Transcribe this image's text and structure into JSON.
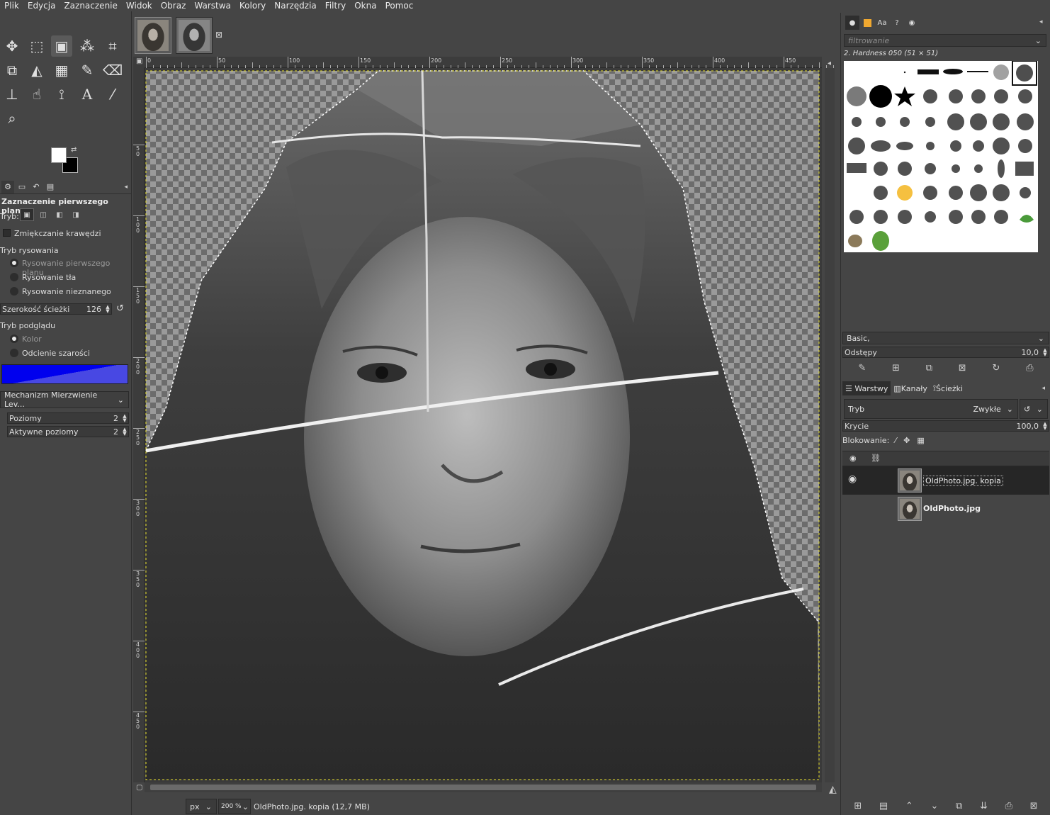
{
  "menu": [
    "Plik",
    "Edycja",
    "Zaznaczenie",
    "Widok",
    "Obraz",
    "Warstwa",
    "Kolory",
    "Narzędzia",
    "Filtry",
    "Okna",
    "Pomoc"
  ],
  "tool_options": {
    "title": "Zaznaczenie pierwszego planu",
    "mode_label": "Tryb:",
    "antialias_label": "Zmiękczanie krawędzi",
    "draw_mode_label": "Tryb rysowania",
    "draw_modes": [
      "Rysowanie pierwszego planu",
      "Rysowanie tła",
      "Rysowanie nieznanego"
    ],
    "stroke_width_label": "Szerokość ścieżki",
    "stroke_width_value": "126",
    "preview_mode_label": "Tryb podglądu",
    "preview_modes": [
      "Kolor",
      "Odcienie szarości"
    ],
    "preview_color": "#0000ee",
    "engine_label": "Mechanizm Mierzwienie Lev...",
    "levels_label": "Poziomy",
    "levels_value": "2",
    "active_levels_label": "Aktywne poziomy",
    "active_levels_value": "2"
  },
  "image_tabs": {
    "close_glyph": "⊠"
  },
  "ruler_top": [
    "0",
    "50",
    "100",
    "150",
    "200",
    "250",
    "300",
    "350",
    "400",
    "450"
  ],
  "ruler_left": [
    "5 0",
    "1 0 0",
    "1 5 0",
    "2 0 0",
    "2 5 0",
    "3 0 0",
    "3 5 0",
    "4 0 0",
    "4 5 0"
  ],
  "status": {
    "unit": "px",
    "zoom": "200 %",
    "info": "OldPhoto.jpg. kopia (12,7 MB)"
  },
  "brushes": {
    "filter_placeholder": "filtrowanie",
    "current_brush": "2. Hardness 050 (51 × 51)",
    "preset": "Basic,",
    "spacing_label": "Odstępy",
    "spacing_value": "10,0"
  },
  "layers": {
    "tabs": [
      "Warstwy",
      "Kanały",
      "Ścieżki"
    ],
    "mode_label": "Tryb",
    "mode_value": "Zwykłe",
    "opacity_label": "Krycie",
    "opacity_value": "100,0",
    "lock_label": "Blokowanie:",
    "items": [
      {
        "name": "OldPhoto.jpg. kopia",
        "visible": true,
        "selected": true
      },
      {
        "name": "OldPhoto.jpg",
        "visible": false,
        "selected": false
      }
    ]
  }
}
